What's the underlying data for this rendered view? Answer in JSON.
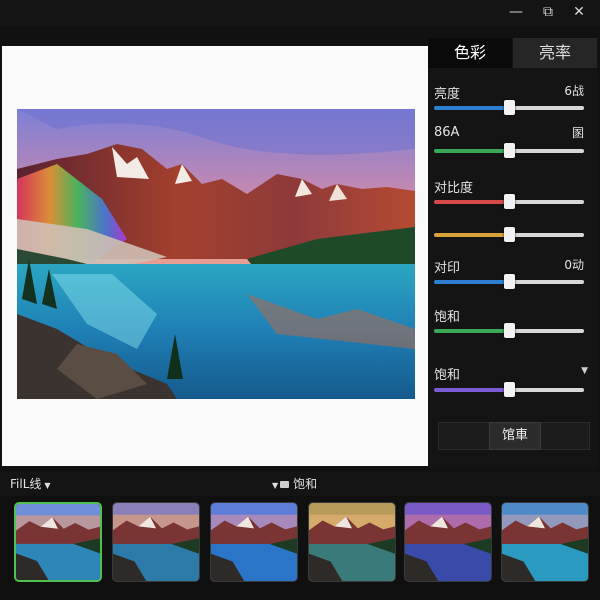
{
  "window": {
    "title": "",
    "minimize_glyph": "—",
    "maximize_glyph": "⧉",
    "close_glyph": "✕"
  },
  "panel": {
    "tabs": [
      {
        "label": "色彩",
        "active": true
      },
      {
        "label": "亮率",
        "active": false
      }
    ],
    "rows": [
      {
        "label": "亮度",
        "value": "6战",
        "track": "#2d7fd3",
        "level": 0.5
      },
      {
        "label": "86A",
        "value": "圂",
        "track": "#3aa857",
        "level": 0.5
      },
      {
        "label": "对比度",
        "value": "",
        "track": "#d84a4a",
        "level": 0.5
      },
      {
        "label": "",
        "value": "",
        "track": "#d8a23a",
        "level": 0.5
      },
      {
        "label": "对印",
        "value": "0动",
        "track": "#2d7fd3",
        "level": 0.5
      },
      {
        "label": "饱和",
        "value": "",
        "track": "#3aa857",
        "level": 0.5
      },
      {
        "label": "饱和",
        "value": "",
        "track": "#7a5cd6",
        "level": 0.5
      }
    ],
    "apply_label": "馆車"
  },
  "strip": {
    "filter_label": "FilL线",
    "saturation_label": "饱和"
  },
  "thumbnails": [
    {
      "tone": "natural",
      "selected": true
    },
    {
      "tone": "warm",
      "selected": false
    },
    {
      "tone": "cool",
      "selected": false
    },
    {
      "tone": "golden",
      "selected": false
    },
    {
      "tone": "violet",
      "selected": false
    },
    {
      "tone": "teal",
      "selected": false
    }
  ],
  "colors": {
    "accent_green": "#4fc14f",
    "panel_bg": "#141414",
    "canvas_bg": "#fafafa"
  },
  "icons": [
    "minimize-icon",
    "maximize-icon",
    "close-icon",
    "chevron-down-icon",
    "folder-icon"
  ]
}
